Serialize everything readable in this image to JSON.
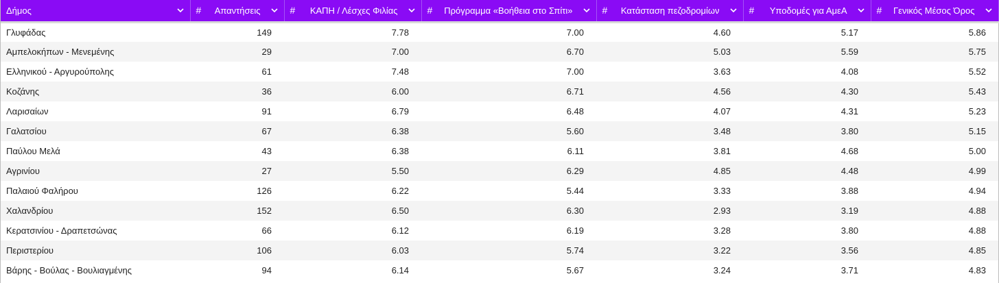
{
  "columns": [
    {
      "label": "Δήμος",
      "numeric": false
    },
    {
      "label": "Απαντήσεις",
      "numeric": true
    },
    {
      "label": "ΚΑΠΗ / Λέσχες Φιλίας",
      "numeric": true
    },
    {
      "label": "Πρόγραμμα «Βοήθεια στο Σπίτι»",
      "numeric": true
    },
    {
      "label": "Κατάσταση πεζοδρομίων",
      "numeric": true
    },
    {
      "label": "Υποδομές για ΑμεΑ",
      "numeric": true
    },
    {
      "label": "Γενικός Μέσος Όρος",
      "numeric": true
    }
  ],
  "numeric_icon": "#",
  "rows": [
    [
      "Γλυφάδας",
      "149",
      "7.78",
      "7.00",
      "4.60",
      "5.17",
      "5.86"
    ],
    [
      "Αμπελοκήπων - Μενεμένης",
      "29",
      "7.00",
      "6.70",
      "5.03",
      "5.59",
      "5.75"
    ],
    [
      "Ελληνικού - Αργυρούπολης",
      "61",
      "7.48",
      "7.00",
      "3.63",
      "4.08",
      "5.52"
    ],
    [
      "Κοζάνης",
      "36",
      "6.00",
      "6.71",
      "4.56",
      "4.30",
      "5.43"
    ],
    [
      "Λαρισαίων",
      "91",
      "6.79",
      "6.48",
      "4.07",
      "4.31",
      "5.23"
    ],
    [
      "Γαλατσίου",
      "67",
      "6.38",
      "5.60",
      "3.48",
      "3.80",
      "5.15"
    ],
    [
      "Παύλου Μελά",
      "43",
      "6.38",
      "6.11",
      "3.81",
      "4.68",
      "5.00"
    ],
    [
      "Αγρινίου",
      "27",
      "5.50",
      "6.29",
      "4.85",
      "4.48",
      "4.99"
    ],
    [
      "Παλαιού Φαλήρου",
      "126",
      "6.22",
      "5.44",
      "3.33",
      "3.88",
      "4.94"
    ],
    [
      "Χαλανδρίου",
      "152",
      "6.50",
      "6.30",
      "2.93",
      "3.19",
      "4.88"
    ],
    [
      "Κερατσινίου - Δραπετσώνας",
      "66",
      "6.12",
      "6.19",
      "3.28",
      "3.80",
      "4.88"
    ],
    [
      "Περιστερίου",
      "106",
      "6.03",
      "5.74",
      "3.22",
      "3.56",
      "4.85"
    ],
    [
      "Βάρης - Βούλας - Βουλιαγμένης",
      "94",
      "6.14",
      "5.67",
      "3.24",
      "3.71",
      "4.83"
    ]
  ],
  "colors": {
    "header_bg": "#8a0bf5",
    "header_text": "#ffffff",
    "alt_row": "#f4f4f4"
  }
}
